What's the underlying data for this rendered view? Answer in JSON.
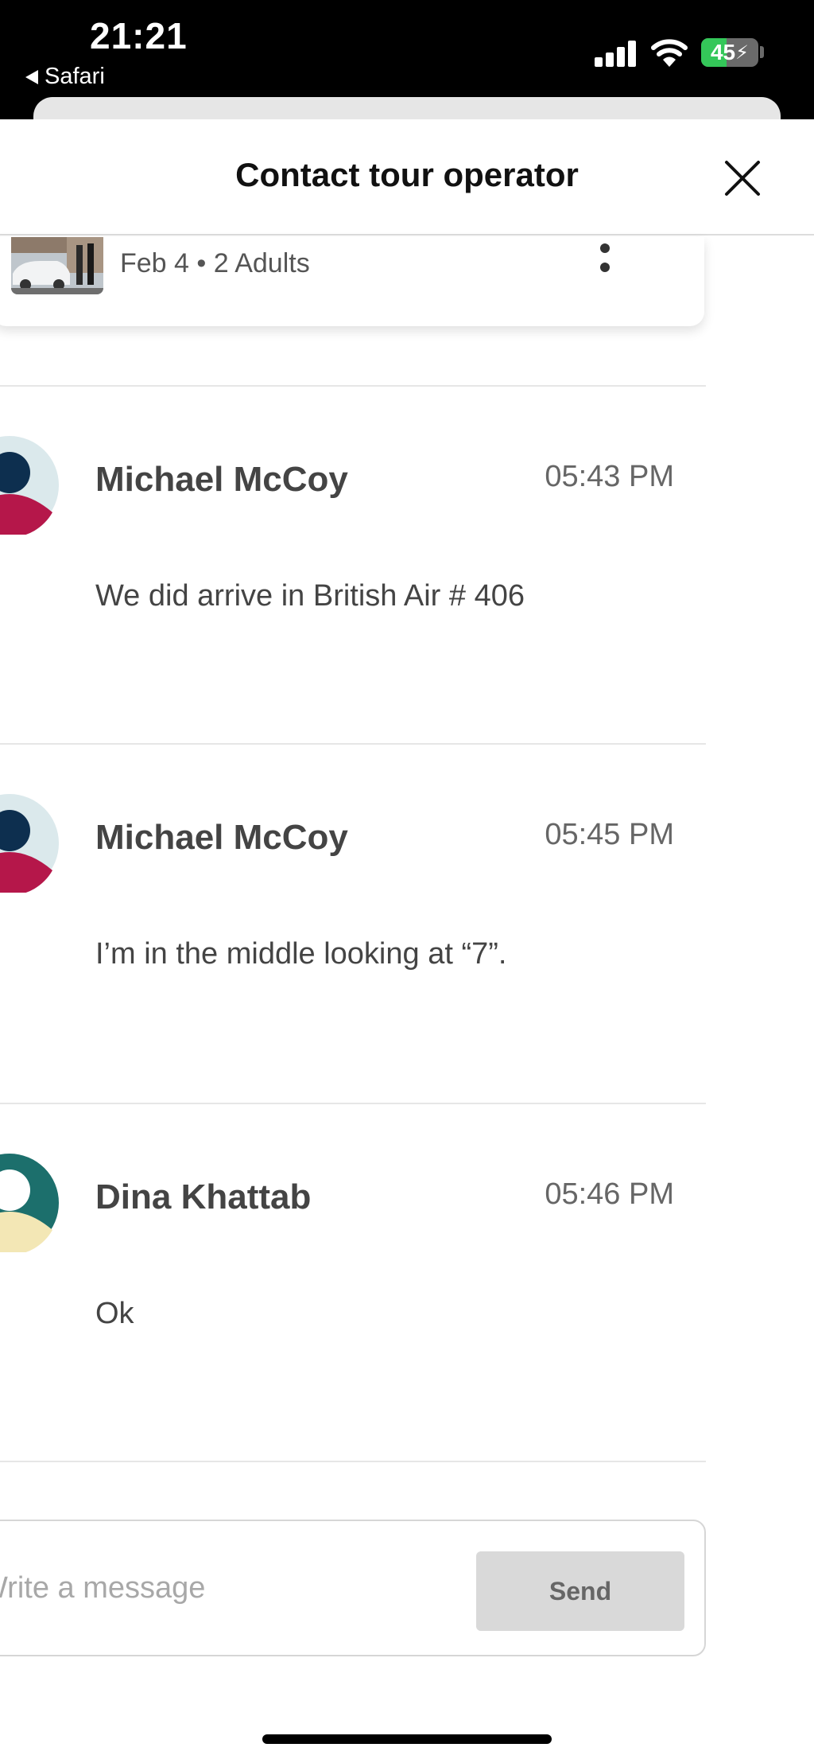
{
  "status_bar": {
    "time": "21:21",
    "back_app": "Safari",
    "battery_level": "45",
    "battery_fraction": 0.45
  },
  "header": {
    "title": "Contact tour operator"
  },
  "booking": {
    "summary": "Feb 4 • 2 Adults"
  },
  "messages": [
    {
      "sender": "Michael McCoy",
      "time": "05:43 PM",
      "text": "We did arrive in British Air # 406",
      "avatar": "person-avatar-red"
    },
    {
      "sender": "Michael McCoy",
      "time": "05:45 PM",
      "text": "I’m in the middle looking at “7”.",
      "avatar": "person-avatar-red"
    },
    {
      "sender": "Dina Khattab",
      "time": "05:46 PM",
      "text": "Ok",
      "avatar": "person-avatar-teal"
    }
  ],
  "composer": {
    "placeholder": "Write a message",
    "send_label": "Send"
  },
  "colors": {
    "avatar_red_head": "#0d2f4f",
    "avatar_red_body": "#b5174a",
    "avatar_red_bg": "#dbe9ec",
    "avatar_teal_bg": "#1c6f6c",
    "avatar_teal_head": "#ffffff",
    "avatar_teal_body": "#f3e7b5",
    "battery_green": "#34c759"
  }
}
